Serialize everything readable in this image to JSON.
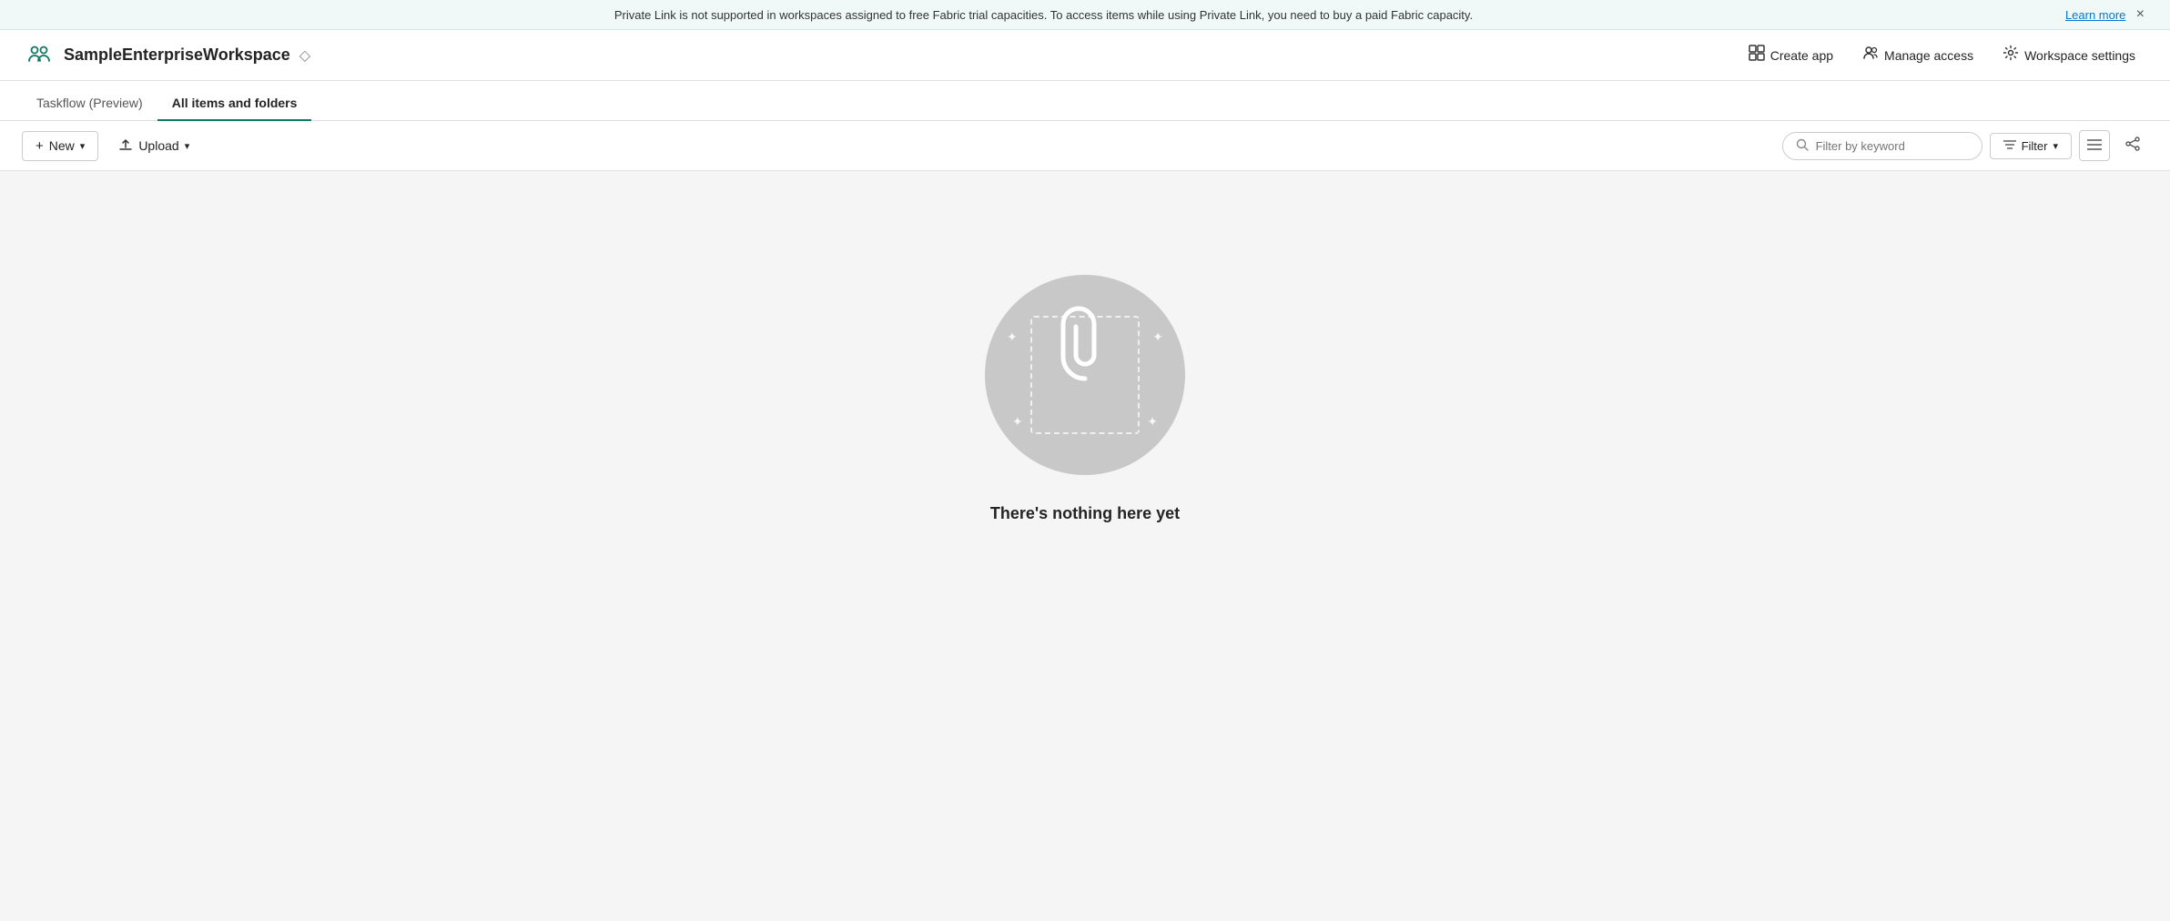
{
  "banner": {
    "message": "Private Link is not supported in workspaces assigned to free Fabric trial capacities. To access items while using Private Link, you need to buy a paid Fabric capacity.",
    "learn_more": "Learn more",
    "close_label": "×"
  },
  "header": {
    "workspace_name": "SampleEnterpriseWorkspace",
    "diamond_icon": "◇",
    "create_app_label": "Create app",
    "manage_access_label": "Manage access",
    "workspace_settings_label": "Workspace settings"
  },
  "tabs": [
    {
      "id": "taskflow",
      "label": "Taskflow (Preview)",
      "active": false
    },
    {
      "id": "all-items",
      "label": "All items and folders",
      "active": true
    }
  ],
  "toolbar": {
    "new_label": "New",
    "upload_label": "Upload",
    "filter_keyword_placeholder": "Filter by keyword",
    "filter_label": "Filter",
    "chevron_down": "▾",
    "lines_icon": "≡",
    "share_icon": "⋮"
  },
  "main": {
    "empty_title": "There's nothing here yet"
  },
  "colors": {
    "accent": "#117865",
    "link": "#0078d4",
    "border": "#e0e0e0"
  }
}
